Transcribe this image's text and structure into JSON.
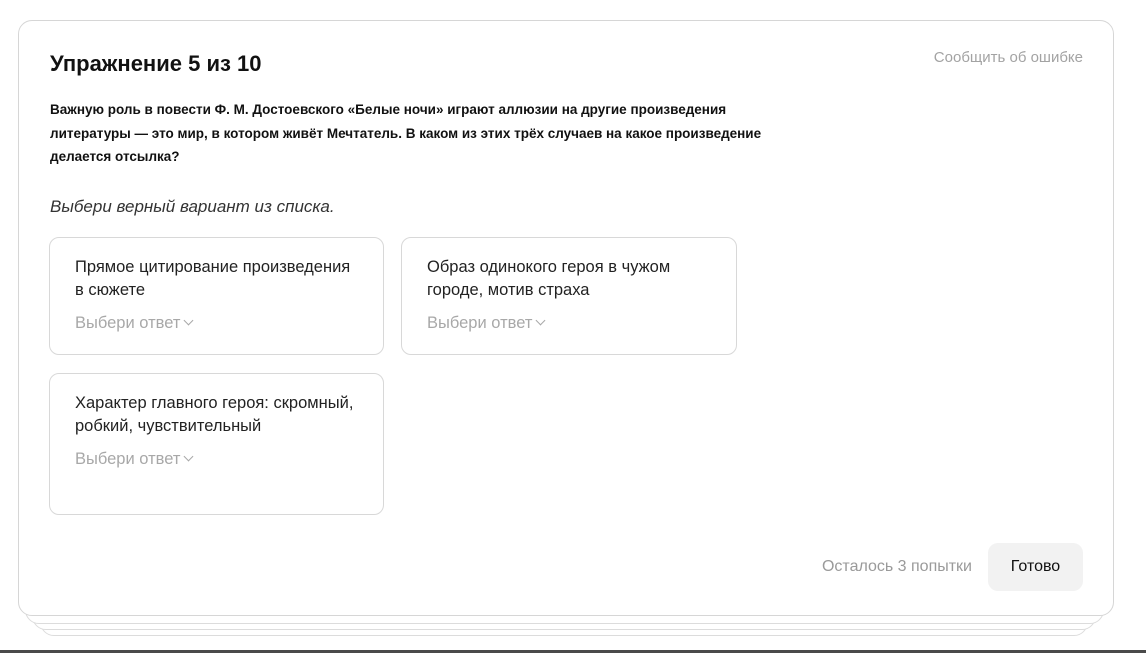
{
  "exercise": {
    "title": "Упражнение 5 из 10",
    "report_link": "Сообщить об ошибке",
    "question": "Важную роль в повести Ф. М. Достоевского «Белые ночи» играют аллюзии на другие произведения литературы — это мир, в котором живёт Мечтатель. В каком из этих трёх случаев на какое произведение делается отсылка?",
    "instruction": "Выбери верный вариант из списка.",
    "options": [
      {
        "text": "Прямое цитирование произведения в сюжете",
        "select_label": "Выбери ответ"
      },
      {
        "text": "Образ одинокого героя в чужом городе, мотив страха",
        "select_label": "Выбери ответ"
      },
      {
        "text": "Характер главного героя: скромный, робкий, чувствительный",
        "select_label": "Выбери ответ"
      }
    ]
  },
  "footer": {
    "attempts_left": "Осталось 3 попытки",
    "done_label": "Готово"
  }
}
